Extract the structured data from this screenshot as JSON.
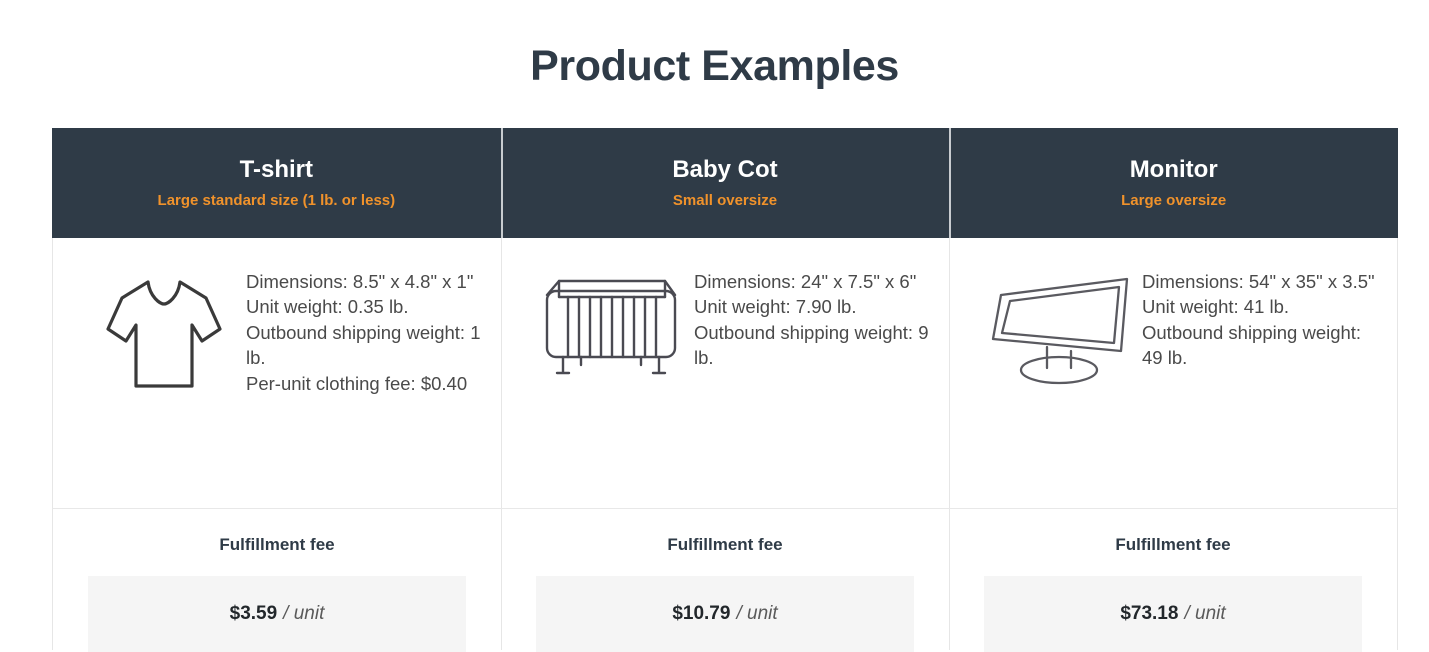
{
  "header": {
    "title": "Product Examples"
  },
  "columns": [
    {
      "icon": "tshirt-icon",
      "name": "T-shirt",
      "size_tier": "Large standard size (1 lb. or less)",
      "specs": [
        "Dimensions: 8.5\" x 4.8\" x 1\"",
        "Unit weight: 0.35 lb.",
        "Outbound shipping weight: 1 lb.",
        "Per-unit clothing fee: $0.40"
      ],
      "fee_label": "Fulfillment fee",
      "fee_amount": "$3.59",
      "fee_unit": "/ unit"
    },
    {
      "icon": "baby-cot-icon",
      "name": "Baby Cot",
      "size_tier": "Small oversize",
      "specs": [
        "Dimensions: 24\" x 7.5\" x 6\"",
        "Unit weight: 7.90 lb.",
        "Outbound shipping weight: 9 lb."
      ],
      "fee_label": "Fulfillment fee",
      "fee_amount": "$10.79",
      "fee_unit": "/ unit"
    },
    {
      "icon": "monitor-icon",
      "name": "Monitor",
      "size_tier": "Large oversize",
      "specs": [
        "Dimensions: 54\" x 35\" x 3.5\"",
        "Unit weight: 41 lb.",
        "Outbound shipping weight: 49 lb."
      ],
      "fee_label": "Fulfillment fee",
      "fee_amount": "$73.18",
      "fee_unit": "/ unit"
    }
  ],
  "colors": {
    "header_background": "#2f3b47",
    "accent_orange": "#f0922b",
    "title_text": "#2f3b47",
    "body_text": "#4a4a4a",
    "fee_box_background": "#f5f5f5",
    "divider": "#e6e6e6"
  }
}
